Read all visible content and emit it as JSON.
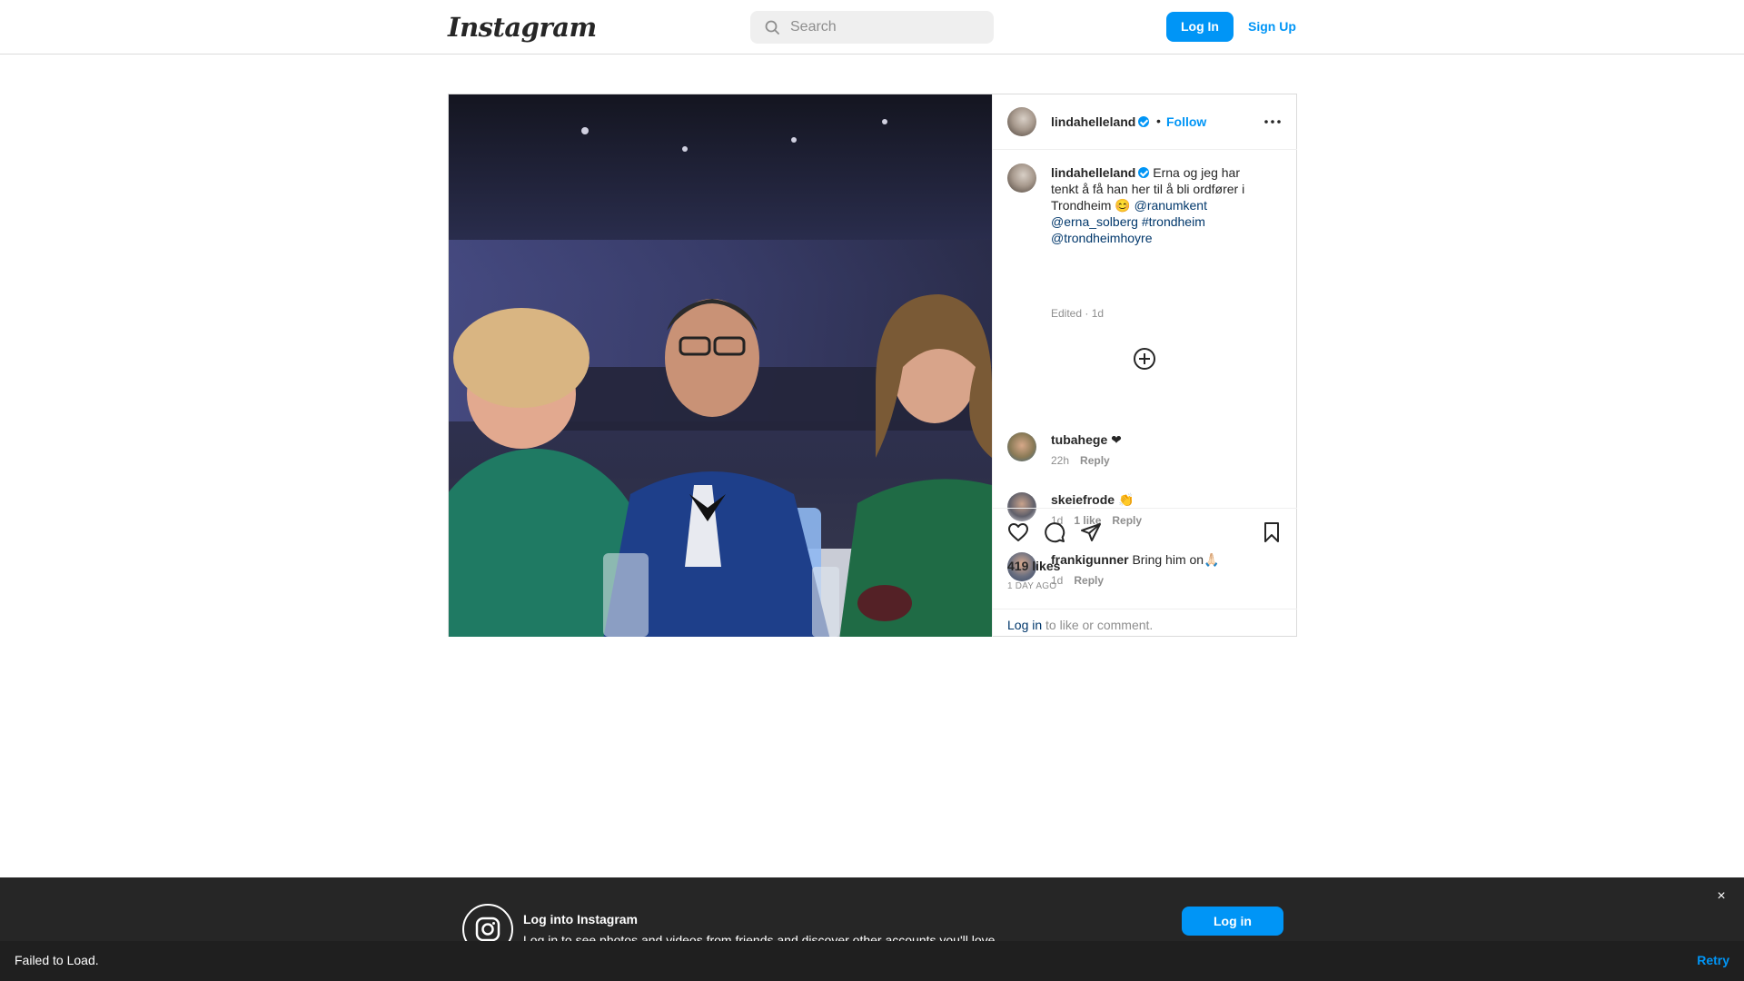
{
  "nav": {
    "logo": "Instagram",
    "search_placeholder": "Search",
    "login_label": "Log In",
    "signup_label": "Sign Up"
  },
  "post": {
    "username": "lindahelleland",
    "dot": "•",
    "follow_label": "Follow",
    "caption": {
      "username": "lindahelleland",
      "text": "Erna og jeg har tenkt å få han her til å bli ordfører i Trondheim 😊",
      "tags": [
        "@ranumkent",
        "@erna_solberg",
        "#trondheim",
        "@trondheimhoyre"
      ],
      "meta": "Edited · 1d"
    },
    "comments": [
      {
        "username": "tubahege",
        "text": "❤",
        "time": "22h",
        "likes": "",
        "reply": "Reply"
      },
      {
        "username": "skeiefrode",
        "text": "👏",
        "time": "1d",
        "likes": "1 like",
        "reply": "Reply"
      },
      {
        "username": "frankigunner",
        "text": "Bring him on🙏🏻",
        "time": "1d",
        "likes": "",
        "reply": "Reply"
      }
    ],
    "likes": "419 likes",
    "posted_ago": "1 DAY AGO",
    "login_prompt_link": "Log in",
    "login_prompt_rest": " to like or comment."
  },
  "banner": {
    "title": "Log into Instagram",
    "subtitle": "Log in to see photos and videos from friends and discover other accounts you'll love.",
    "button": "Log in",
    "close": "×"
  },
  "toast": {
    "message": "Failed to Load.",
    "retry": "Retry"
  },
  "colors": {
    "accent": "#0095f6",
    "link": "#00376b",
    "muted": "#8e8e8e"
  }
}
